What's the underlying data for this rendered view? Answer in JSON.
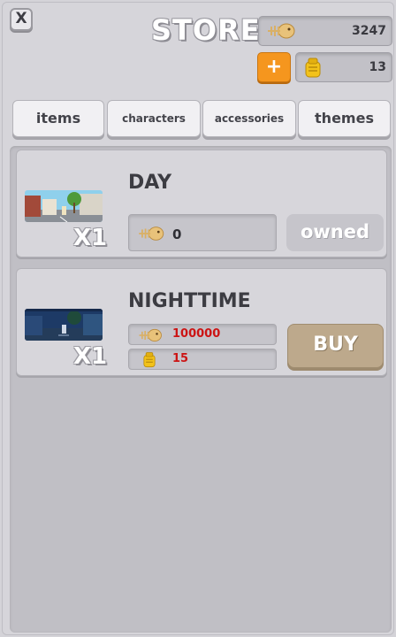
{
  "header": {
    "close_label": "X",
    "title": "STORE",
    "fish_balance": "3247",
    "coin_balance": "13",
    "add_label": "+"
  },
  "tabs": [
    {
      "label": "items"
    },
    {
      "label": "characters"
    },
    {
      "label": "accessories"
    },
    {
      "label": "themes"
    }
  ],
  "themes": [
    {
      "name": "DAY",
      "quantity": "X1",
      "fish_price": "0",
      "action_label": "owned"
    },
    {
      "name": "NIGHTTIME",
      "quantity": "X1",
      "fish_price": "100000",
      "coin_price": "15",
      "action_label": "BUY"
    }
  ],
  "colors": {
    "accent_orange": "#f5961e",
    "buy_button": "#bda98c",
    "price_red": "#cc1414"
  },
  "icons": {
    "fish": "fish-bone-icon",
    "coin": "gold-bag-icon"
  }
}
